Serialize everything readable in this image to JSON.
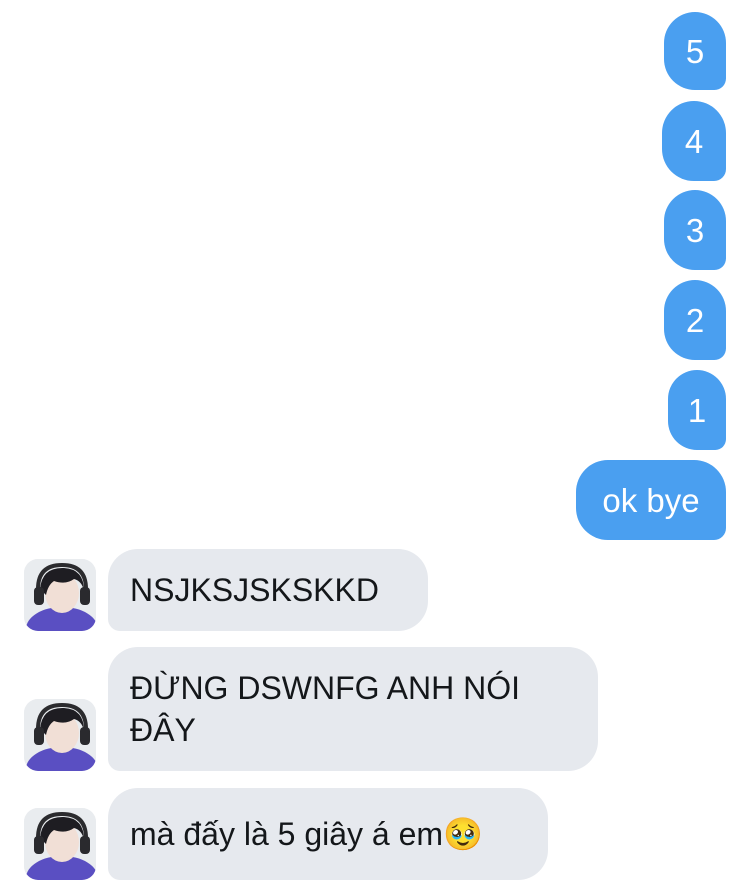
{
  "outgoing": [
    {
      "text": "5"
    },
    {
      "text": "4"
    },
    {
      "text": "3"
    },
    {
      "text": "2"
    },
    {
      "text": "1"
    },
    {
      "text": "ok bye"
    }
  ],
  "incoming": [
    {
      "text": "NSJKSJSKSKKD"
    },
    {
      "text": "ĐỪNG DSWNFG ANH NÓI ĐÂY"
    },
    {
      "text": "mà đấy là 5 giây á em🥹"
    }
  ],
  "colors": {
    "outgoing_bubble": "#4a9ff0",
    "incoming_bubble": "#e6e9ee",
    "background": "#ffffff"
  },
  "icons": {
    "sender_avatar": "avatar-boy-with-headphones"
  }
}
